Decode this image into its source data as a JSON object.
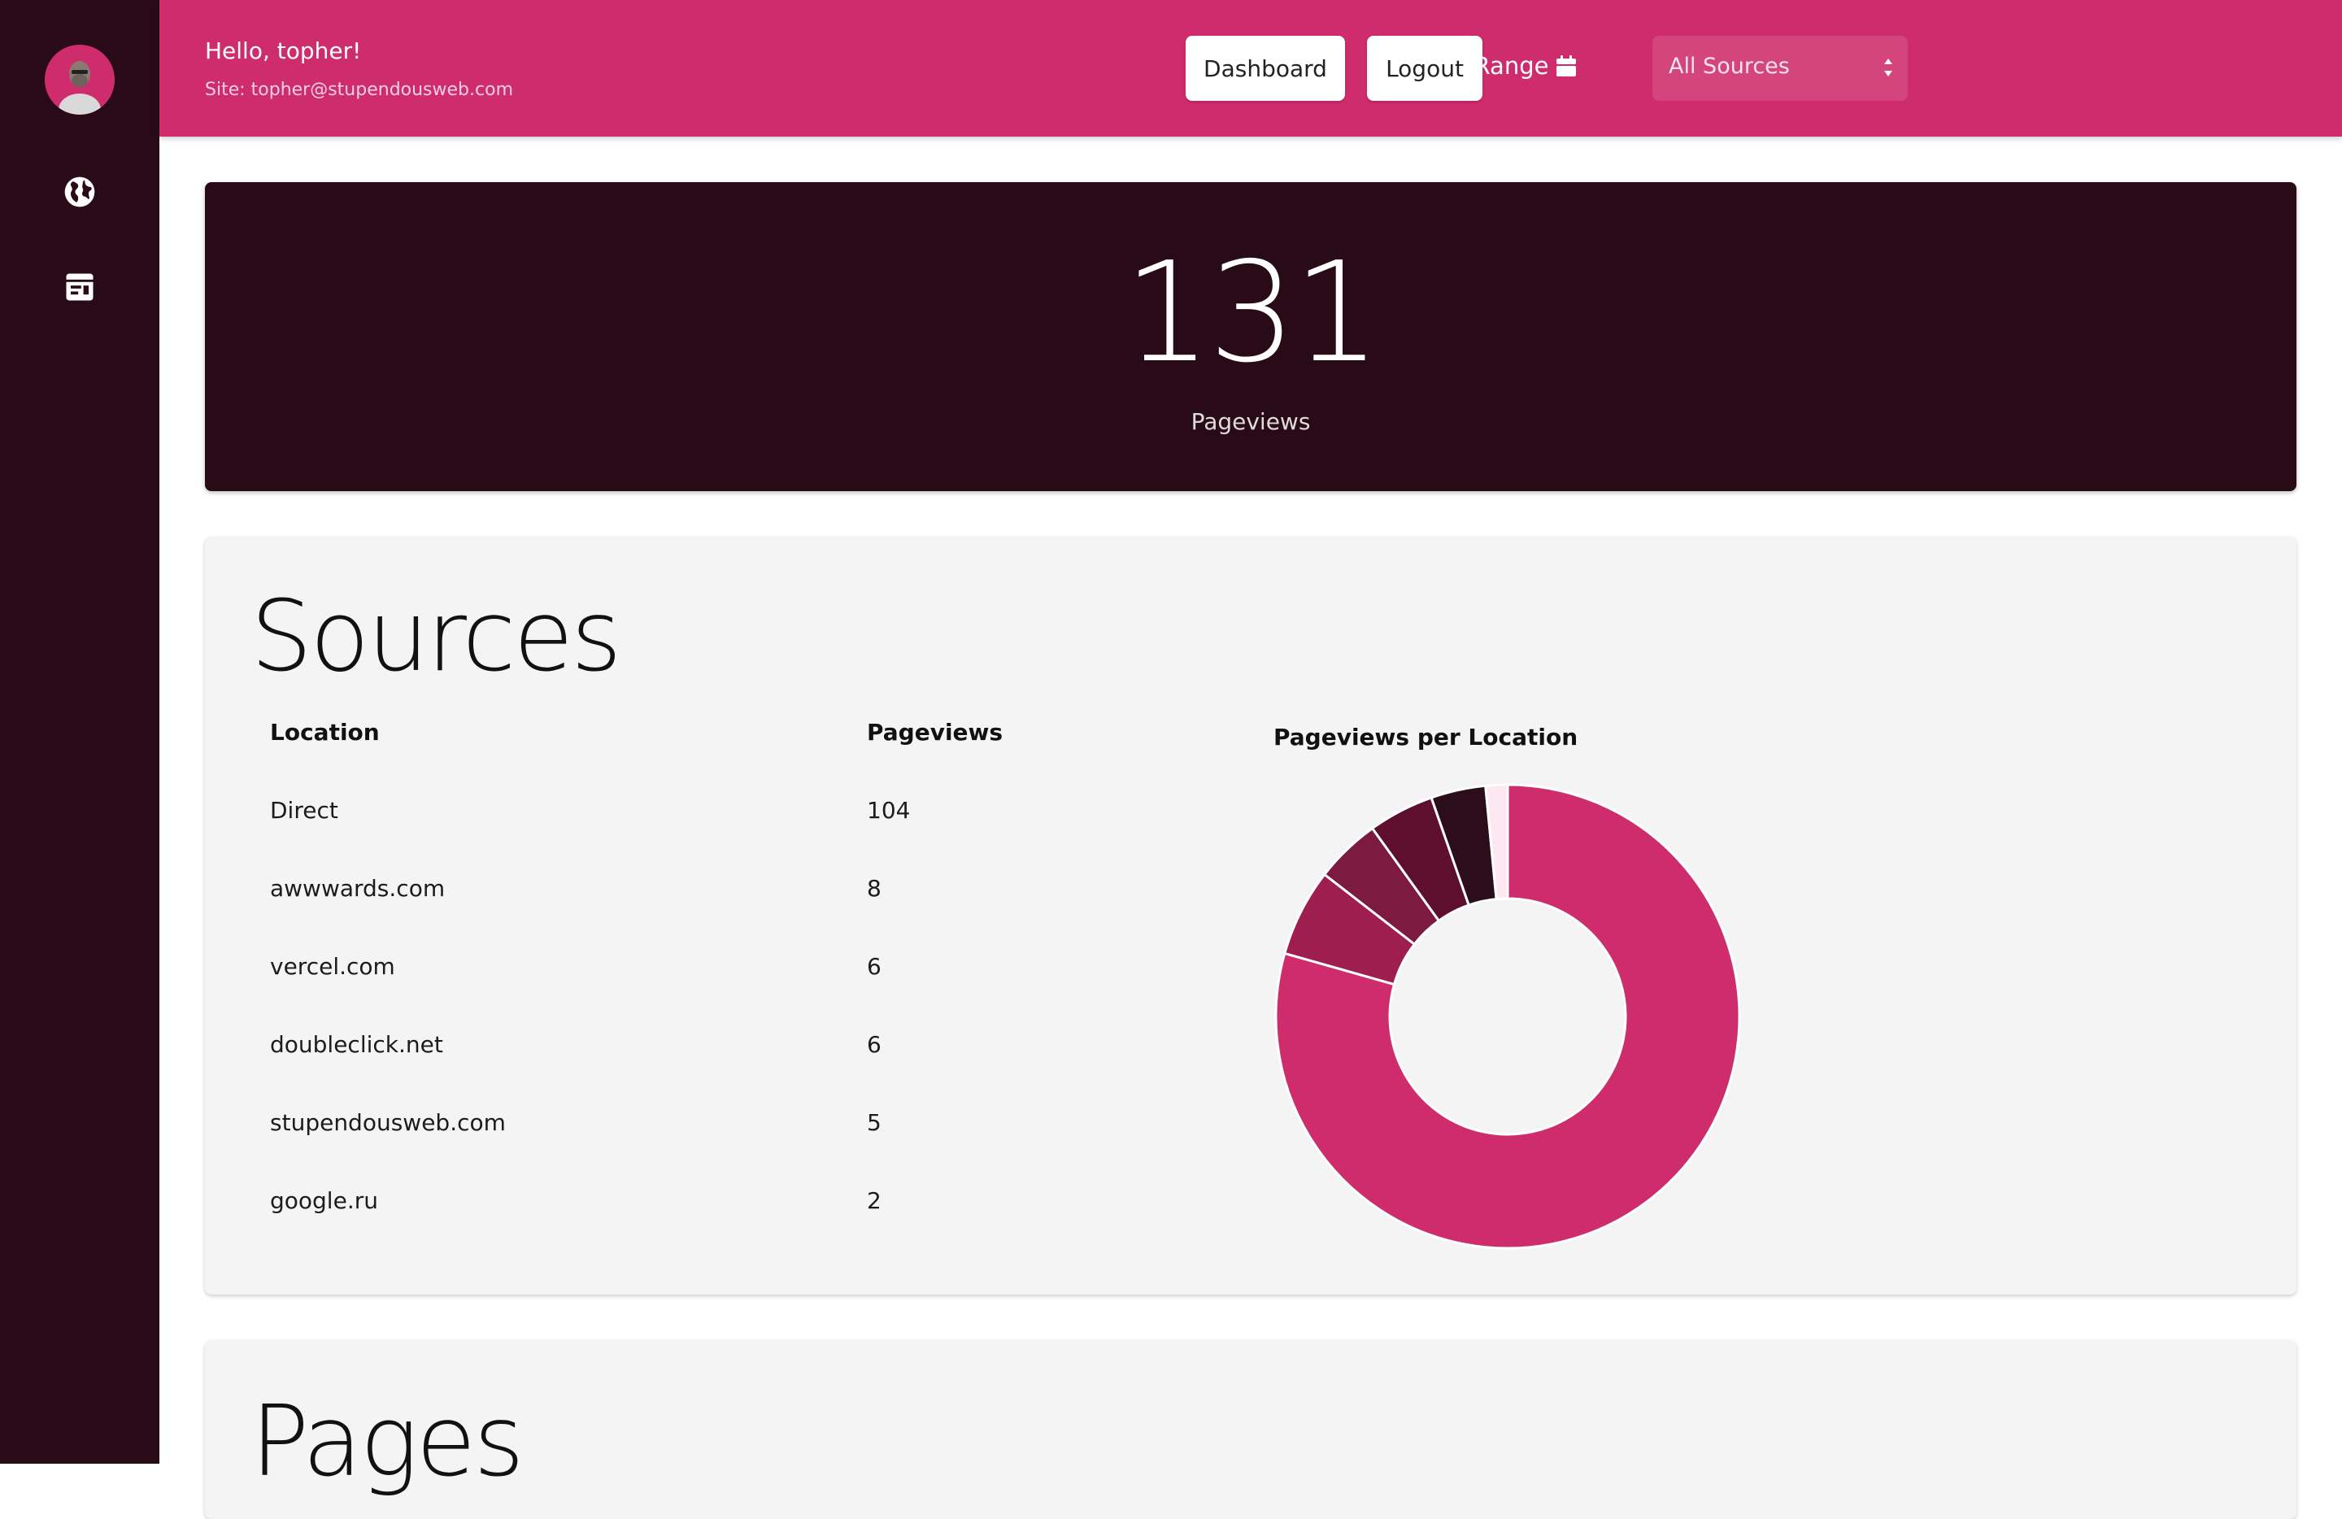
{
  "header": {
    "greeting": "Hello, topher!",
    "site": "Site: topher@stupendousweb.com",
    "date_range_label": "Date Range",
    "source_select_value": "All Sources",
    "dashboard_label": "Dashboard",
    "logout_label": "Logout"
  },
  "sidebar": {
    "items": [
      {
        "icon": "globe-icon"
      },
      {
        "icon": "article-icon"
      }
    ]
  },
  "hero": {
    "value": "131",
    "label": "Pageviews"
  },
  "sources": {
    "title": "Sources",
    "columns": [
      "Location",
      "Pageviews"
    ],
    "rows": [
      [
        "Direct",
        "104"
      ],
      [
        "awwwards.com",
        "8"
      ],
      [
        "vercel.com",
        "6"
      ],
      [
        "doubleclick.net",
        "6"
      ],
      [
        "stupendousweb.com",
        "5"
      ],
      [
        "google.ru",
        "2"
      ]
    ]
  },
  "chart_data": {
    "type": "pie",
    "title": "Pageviews per Location",
    "categories": [
      "Direct",
      "awwwards.com",
      "vercel.com",
      "doubleclick.net",
      "stupendousweb.com",
      "google.ru"
    ],
    "values": [
      104,
      8,
      6,
      6,
      5,
      2
    ],
    "colors": [
      "#cf2c6d",
      "#9e1f4f",
      "#7c1a40",
      "#5e0f2e",
      "#2c0d1a",
      "#fde8f1"
    ],
    "donut": true
  },
  "pages": {
    "title": "Pages"
  },
  "colors": {
    "accent": "#cf2c6d",
    "dark": "#280b17",
    "card": "#f4f4f4"
  }
}
